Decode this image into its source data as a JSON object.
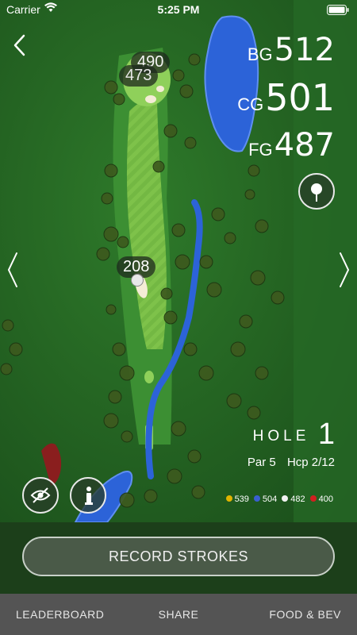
{
  "status_bar": {
    "carrier": "Carrier",
    "time": "5:25 PM"
  },
  "map": {
    "pin_back": "490",
    "pin_front": "473",
    "layup": "208"
  },
  "yardages": [
    {
      "label": "BG",
      "value": "512"
    },
    {
      "label": "CG",
      "value": "501"
    },
    {
      "label": "FG",
      "value": "487"
    }
  ],
  "hole": {
    "label": "HOLE",
    "number": "1",
    "par": "Par 5",
    "hcp": "Hcp 2/12"
  },
  "tees": [
    {
      "color": "#e0b400",
      "yards": "539"
    },
    {
      "color": "#3a5fd0",
      "yards": "504"
    },
    {
      "color": "#f2f2f2",
      "yards": "482"
    },
    {
      "color": "#d02020",
      "yards": "400"
    }
  ],
  "actions": {
    "record": "RECORD STROKES"
  },
  "tabs": {
    "leaderboard": "LEADERBOARD",
    "share": "SHARE",
    "food": "FOOD & BEV"
  },
  "icons": {
    "back": "chevron-left-icon",
    "prev": "angle-left-icon",
    "next": "angle-right-icon",
    "flag": "flag-pin-icon",
    "hide": "eye-off-icon",
    "info": "info-icon"
  }
}
